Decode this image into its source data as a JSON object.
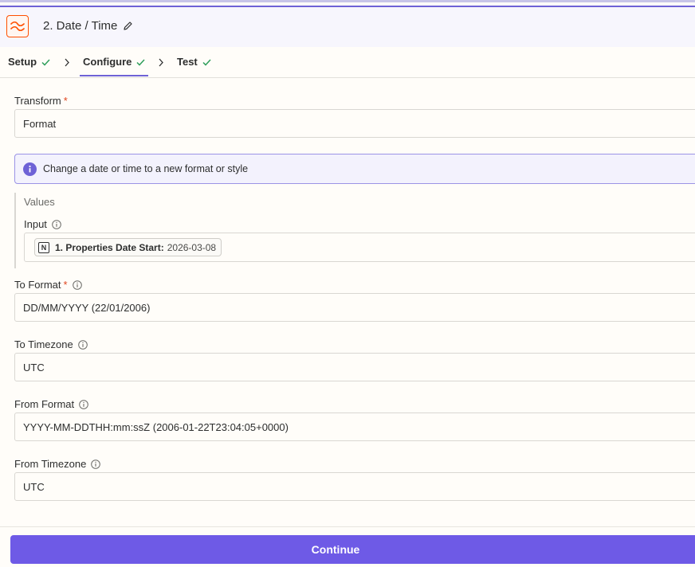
{
  "header": {
    "title": "2. Date / Time",
    "icon": "formatter-icon",
    "accent": "#ff4f00"
  },
  "tabs": [
    {
      "label": "Setup",
      "complete": true
    },
    {
      "label": "Configure",
      "complete": true,
      "active": true
    },
    {
      "label": "Test",
      "complete": true
    }
  ],
  "form": {
    "transform": {
      "label": "Transform",
      "required": true,
      "value": "Format"
    },
    "banner": {
      "text": "Change a date or time to a new format or style"
    },
    "values": {
      "title": "Values",
      "input": {
        "label": "Input",
        "pill": {
          "name": "1. Properties Date Start:",
          "value": "2026-03-08",
          "icon": "notion-icon"
        }
      }
    },
    "to_format": {
      "label": "To Format",
      "required": true,
      "value": "DD/MM/YYYY (22/01/2006)"
    },
    "to_timezone": {
      "label": "To Timezone",
      "value": "UTC"
    },
    "from_format": {
      "label": "From Format",
      "value": "YYYY-MM-DDTHH:mm:ssZ (2006-01-22T23:04:05+0000)"
    },
    "from_timezone": {
      "label": "From Timezone",
      "value": "UTC"
    }
  },
  "footer": {
    "continue_label": "Continue",
    "button_color": "#6e5ae6"
  },
  "colors": {
    "check": "#2e9e5a",
    "primary": "#6e62d6",
    "required": "#e0451e"
  }
}
